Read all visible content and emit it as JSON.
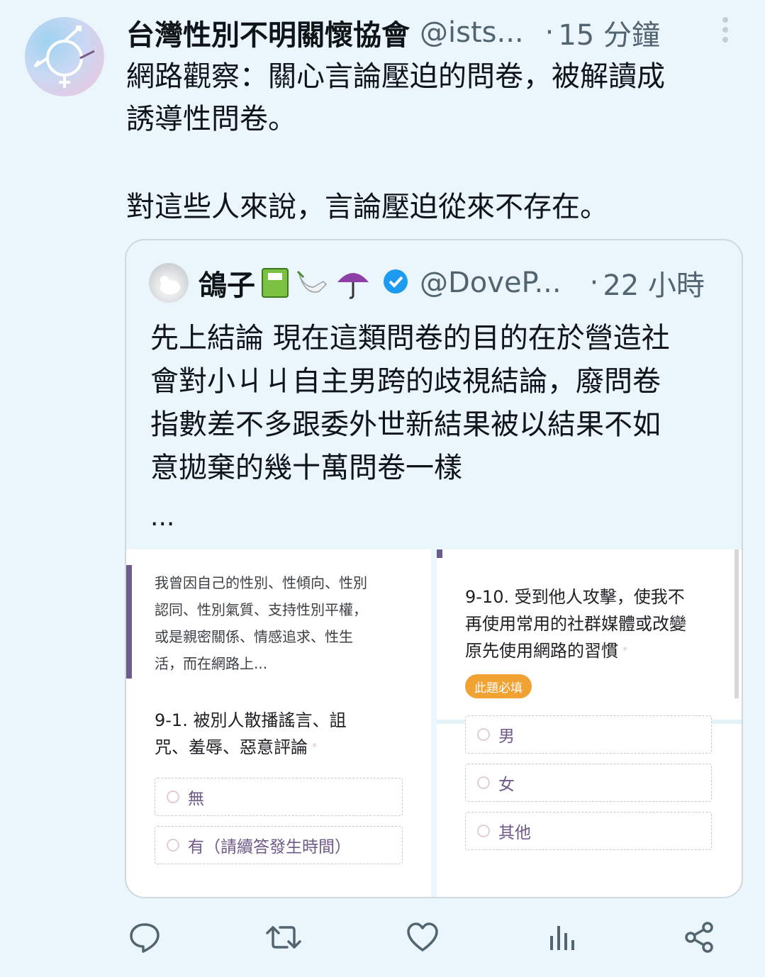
{
  "tweet": {
    "author_name": "台灣性別不明關懷協會",
    "author_handle": "@ists...",
    "dot": "·",
    "time": "15 分鐘",
    "text_lines": [
      "網路觀察：關心言論壓迫的問卷，被解讀成",
      "誘導性問卷。",
      "對這些人來說，言論壓迫從來不存在。"
    ]
  },
  "quote": {
    "author_name": "鴿子",
    "author_handle": "@DoveP...",
    "dot": "·",
    "time": "22 小時",
    "text_lines": [
      "先上結論 現在這類問卷的目的在於營造社",
      "會對小ㄐㄐ自主男跨的歧視結論，廢問卷",
      "指數差不多跟委外世新結果被以結果不如",
      "意拋棄的幾十萬問卷一樣"
    ],
    "ellipsis": "...",
    "image_left": {
      "intro_lines": [
        "我曾因自己的性別、性傾向、性別",
        "認同、性別氣質、支持性別平權，",
        "或是親密關係、情感追求、性生",
        "活，而在網路上..."
      ],
      "question_lines": [
        "9-1. 被別人散播謠言、詛",
        "咒、羞辱、惡意評論"
      ],
      "required_star": "*",
      "options": [
        "無",
        "有（請續答發生時間）"
      ]
    },
    "image_right": {
      "question_lines": [
        "9-10. 受到他人攻擊，使我不",
        "再使用常用的社群媒體或改變",
        "原先使用網路的習慣"
      ],
      "required_star": "*",
      "badge": "此題必填",
      "options": [
        "男",
        "女",
        "其他"
      ]
    }
  },
  "actions": [
    "reply-icon",
    "retweet-icon",
    "like-icon",
    "views-icon",
    "share-icon"
  ],
  "colors": {
    "background": "#eaf6fb",
    "text": "#0f1419",
    "muted": "#536471",
    "verified": "#1d9bf0",
    "badge": "#f0a233",
    "accent_purple": "#6b5c8a"
  }
}
